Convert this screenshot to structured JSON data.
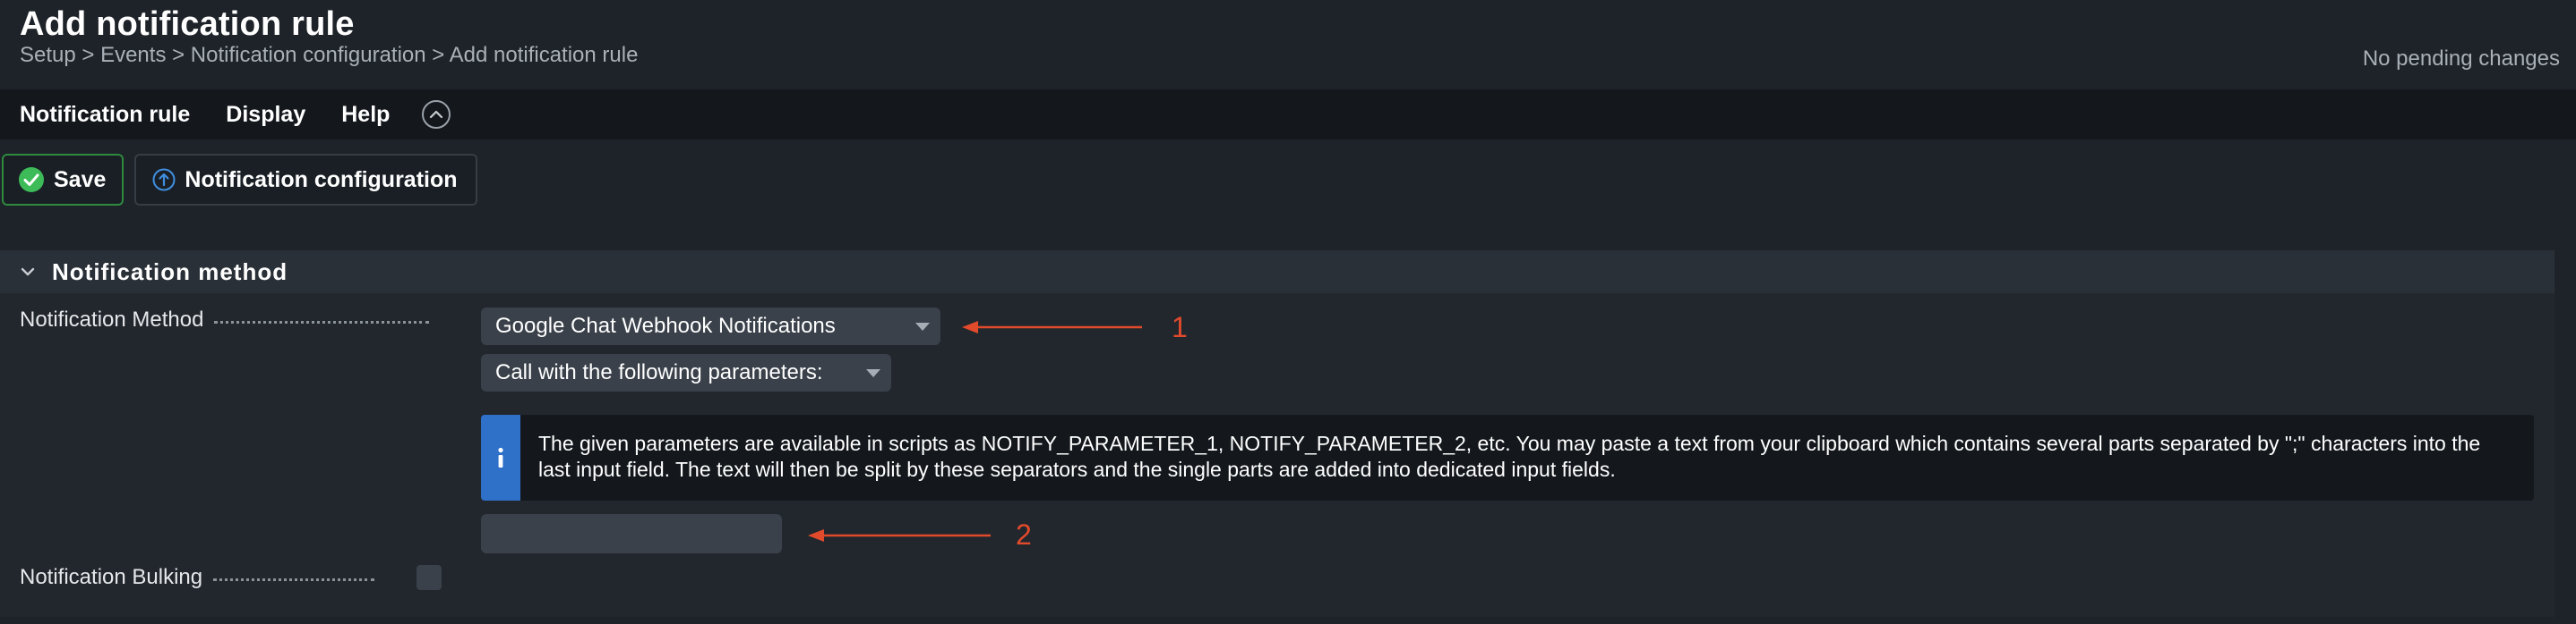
{
  "header": {
    "title": "Add notification rule",
    "breadcrumb": "Setup > Events > Notification configuration > Add notification rule",
    "pending": "No pending changes"
  },
  "menubar": {
    "items": [
      "Notification rule",
      "Display",
      "Help"
    ]
  },
  "toolbar": {
    "save_label": "Save",
    "config_label": "Notification configuration"
  },
  "section": {
    "title": "Notification method",
    "method_label": "Notification Method",
    "method_value": "Google Chat Webhook Notifications",
    "params_value": "Call with the following parameters:",
    "info_text": "The given parameters are available in scripts as NOTIFY_PARAMETER_1, NOTIFY_PARAMETER_2, etc. You may paste a text from your clipboard which contains several parts separated by \";\" characters into the last input field. The text will then be split by these separators and the single parts are added into dedicated input fields.",
    "param_input_value": "",
    "bulking_label": "Notification Bulking"
  },
  "annotations": {
    "one": "1",
    "two": "2"
  },
  "colors": {
    "background": "#1e2329",
    "menubar": "#14181d",
    "save_border": "#2f8a3f",
    "save_icon": "#3dbb58",
    "info_accent": "#2f70c9",
    "annotation": "#e24a2c"
  }
}
